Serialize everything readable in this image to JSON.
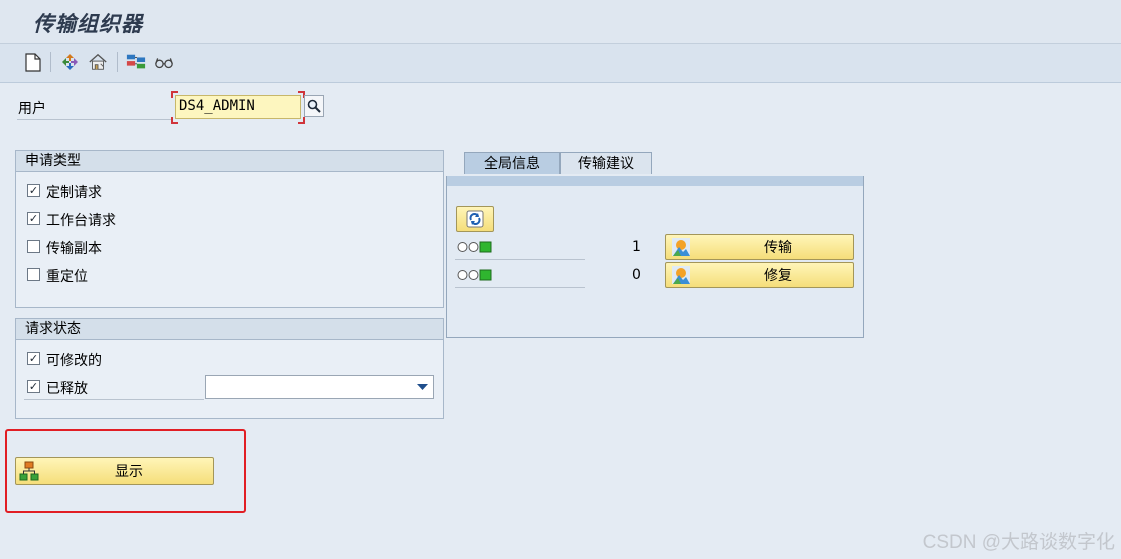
{
  "window": {
    "title": "传输组织器"
  },
  "toolbar": {
    "icons": [
      "new-document-icon",
      "organizer-icon",
      "house-icon",
      "settings-icon",
      "glasses-icon"
    ]
  },
  "user": {
    "label": "用户",
    "value": "DS4_ADMIN"
  },
  "request_type": {
    "title": "申请类型",
    "items": [
      {
        "label": "定制请求",
        "checked": true
      },
      {
        "label": "工作台请求",
        "checked": true
      },
      {
        "label": "传输副本",
        "checked": false
      },
      {
        "label": "重定位",
        "checked": false
      }
    ]
  },
  "request_status": {
    "title": "请求状态",
    "items": [
      {
        "label": "可修改的",
        "checked": true
      },
      {
        "label": "已释放",
        "checked": true
      }
    ],
    "release_select": ""
  },
  "tabs": [
    {
      "label": "全局信息",
      "active": true
    },
    {
      "label": "传输建议",
      "active": false
    }
  ],
  "global_info": {
    "rows": [
      {
        "count": "1",
        "button": "传输"
      },
      {
        "count": "0",
        "button": "修复"
      }
    ]
  },
  "display_button": {
    "label": "显示"
  },
  "watermark": "CSDN @大路谈数字化"
}
